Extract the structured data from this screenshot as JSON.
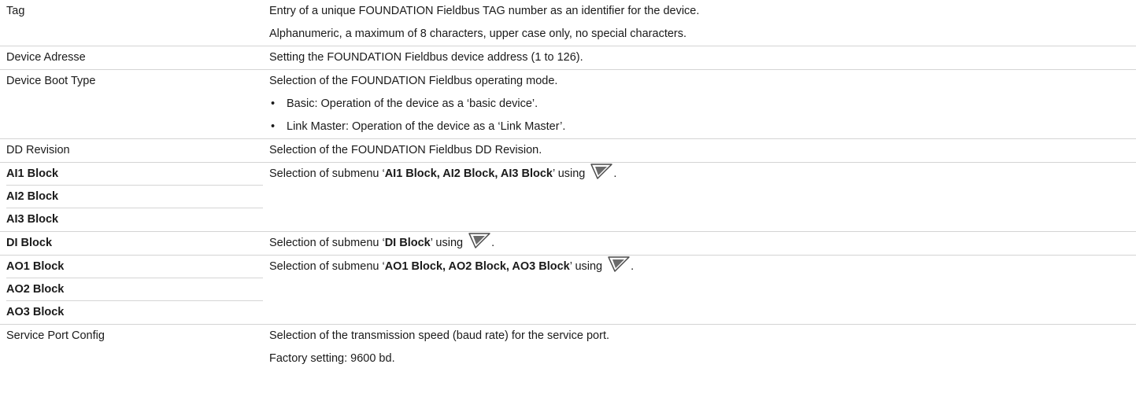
{
  "rows": {
    "tag": {
      "param": "Tag",
      "desc1": "Entry of a unique FOUNDATION Fieldbus TAG number as an identifier for the device.",
      "desc2": "Alphanumeric, a maximum of 8 characters, upper case only, no special characters."
    },
    "device_address": {
      "param": "Device Adresse",
      "desc": "Setting the FOUNDATION Fieldbus device address (1 to 126)."
    },
    "device_boot_type": {
      "param": "Device Boot Type",
      "desc": "Selection of the FOUNDATION Fieldbus operating mode.",
      "bullet_char": "•",
      "bullets": [
        "Basic: Operation of the device as a ‘basic device’.",
        "Link Master: Operation of the device as a ‘Link Master’."
      ]
    },
    "dd_revision": {
      "param": "DD Revision",
      "desc": "Selection of the FOUNDATION Fieldbus DD Revision."
    },
    "ai_blocks": {
      "params": [
        "AI1 Block",
        "AI2 Block",
        "AI3 Block"
      ],
      "desc_prefix": "Selection of submenu ‘",
      "desc_bold": "AI1 Block, AI2 Block, AI3 Block",
      "desc_suffix": "’ using",
      "desc_end": "."
    },
    "di_block": {
      "param": "DI Block",
      "desc_prefix": "Selection of submenu ‘",
      "desc_bold": "DI Block",
      "desc_suffix": "’ using",
      "desc_end": "."
    },
    "ao_blocks": {
      "params": [
        "AO1 Block",
        "AO2 Block",
        "AO3 Block"
      ],
      "desc_prefix": "Selection of submenu ‘",
      "desc_bold": "AO1 Block, AO2 Block, AO3 Block",
      "desc_suffix": "’ using",
      "desc_end": "."
    },
    "service_port": {
      "param": "Service Port Config",
      "desc1": "Selection of the transmission speed (baud rate) for the service port.",
      "desc2": "Factory setting: 9600 bd."
    }
  },
  "icons": {
    "submenu_key": "down-arrow-key-icon",
    "key_color": "#4a4a4a"
  }
}
